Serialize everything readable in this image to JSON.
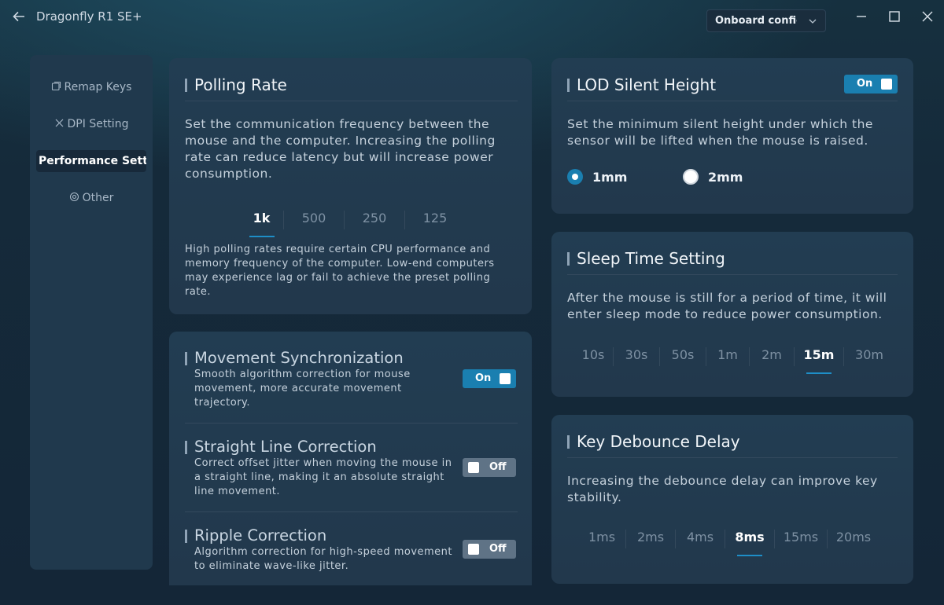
{
  "app": {
    "title": "Dragonfly R1 SE+",
    "profile_select": "Onboard configuration"
  },
  "sidebar": {
    "items": [
      {
        "label": "Remap Keys",
        "icon": "remap-icon"
      },
      {
        "label": "DPI Setting",
        "icon": "dpi-icon"
      },
      {
        "label": "Performance Settings",
        "active": true
      },
      {
        "label": "Other",
        "icon": "settings-icon"
      }
    ]
  },
  "polling": {
    "title": "Polling Rate",
    "description": "Set the communication frequency between the mouse and the computer. Increasing the polling rate can reduce latency but will increase power consumption.",
    "options": [
      "1k",
      "500",
      "250",
      "125"
    ],
    "selected": "1k",
    "note": "High polling rates require certain CPU performance and memory frequency of the computer. Low-end computers may experience lag or fail to achieve the preset polling rate."
  },
  "features": [
    {
      "title": "Movement Synchronization",
      "description": "Smooth algorithm correction for mouse movement, more accurate movement trajectory.",
      "toggle": "On"
    },
    {
      "title": "Straight Line Correction",
      "description": "Correct offset jitter when moving the mouse in a straight line, making it an absolute straight line movement.",
      "toggle": "Off"
    },
    {
      "title": "Ripple Correction",
      "description": "Algorithm correction for high-speed movement to eliminate wave-like jitter.",
      "toggle": "Off"
    }
  ],
  "lod": {
    "title": "LOD Silent Height",
    "toggle": "On",
    "description": "Set the minimum silent height under which the sensor will be lifted when the mouse is raised.",
    "options": [
      "1mm",
      "2mm"
    ],
    "selected": "1mm"
  },
  "sleep": {
    "title": "Sleep Time Setting",
    "description": "After the mouse is still for a period of time, it will enter sleep mode to reduce power consumption.",
    "options": [
      "10s",
      "30s",
      "50s",
      "1m",
      "2m",
      "15m",
      "30m"
    ],
    "selected": "15m"
  },
  "debounce": {
    "title": "Key Debounce Delay",
    "description": "Increasing the debounce delay can improve key stability.",
    "options": [
      "1ms",
      "2ms",
      "4ms",
      "8ms",
      "15ms",
      "20ms"
    ],
    "selected": "8ms"
  },
  "colors": {
    "accent": "#1a7fb0",
    "card": "#223d52",
    "background": "#142637"
  }
}
